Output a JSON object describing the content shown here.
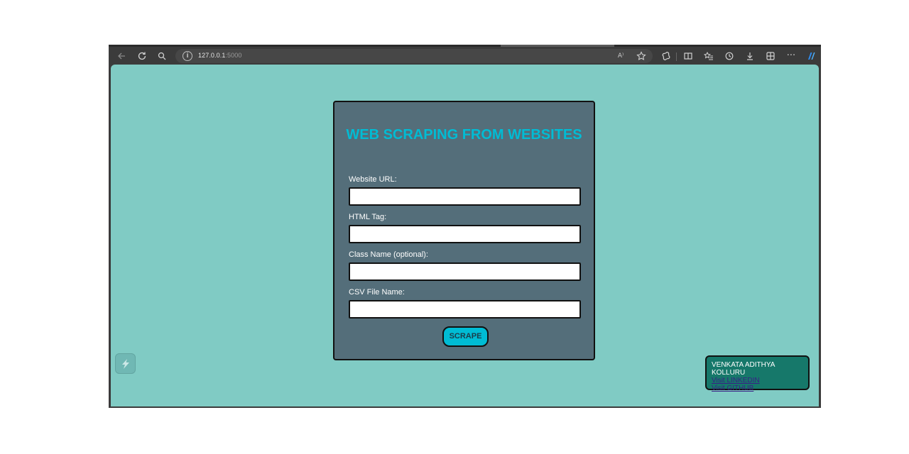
{
  "browser": {
    "address_host": "127.0.0.1",
    "address_port": ":5000",
    "toolbar_icons": [
      "back-arrow-icon",
      "refresh-icon",
      "search-icon",
      "info-icon",
      "read-aloud-icon",
      "favorite-star-icon",
      "extensions-icon",
      "split-screen-icon",
      "favorites-icon",
      "history-icon",
      "downloads-icon",
      "collections-icon",
      "more-icon",
      "copilot-icon"
    ],
    "read_aloud_glyph": "A⁾",
    "more_glyph": "···"
  },
  "form": {
    "title": "WEB SCRAPING FROM WEBSITES",
    "fields": [
      {
        "label": "Website URL:",
        "value": ""
      },
      {
        "label": "HTML Tag:",
        "value": ""
      },
      {
        "label": "Class Name (optional):",
        "value": ""
      },
      {
        "label": "CSV File Name:",
        "value": ""
      }
    ],
    "submit_label": "SCRAPE"
  },
  "footer": {
    "name": "VENKATA ADITHYA KOLLURU",
    "linkedin_label": "Visit LINKEDIN",
    "github_label": "Visit GITHUB"
  },
  "colors": {
    "page_background": "#80cbc4",
    "card_background": "#546e7a",
    "accent": "#00bcd4",
    "footer_background": "#16786a",
    "link": "#3a1f86"
  }
}
